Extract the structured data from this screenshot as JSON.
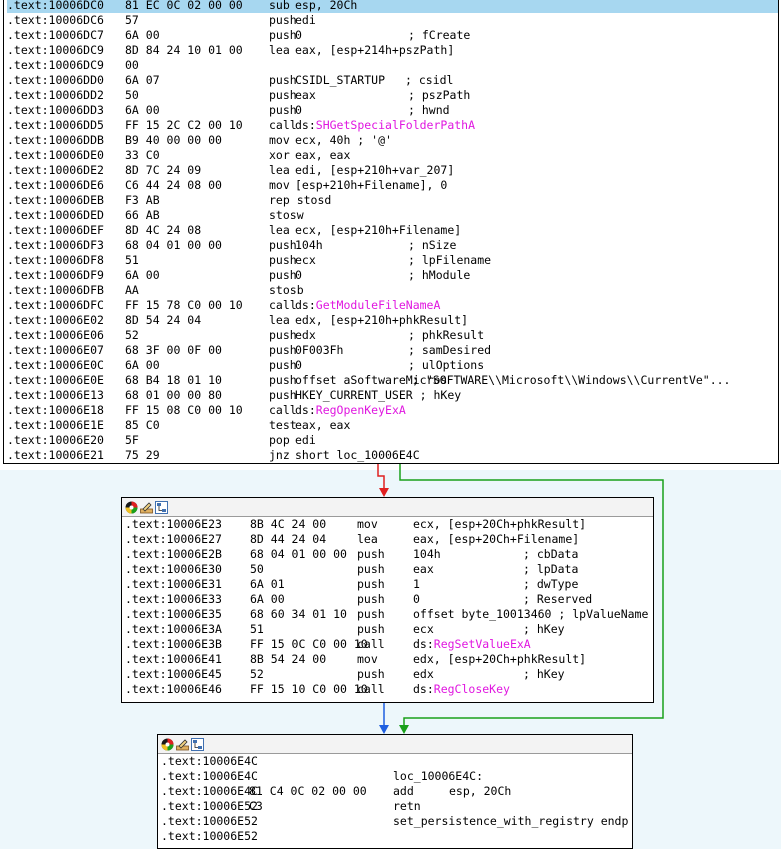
{
  "colors": {
    "api_pink": "#e017e0",
    "edge_red": "#e02020",
    "edge_green": "#1aa01a",
    "edge_blue": "#1f5fe0",
    "selected_row": "#a7d7f0",
    "background_wash": "#edf7fb"
  },
  "block_icons": [
    "graph-color-icon",
    "rename-pencil-icon",
    "graph-flowchart-icon"
  ],
  "blocks": [
    {
      "id": "main",
      "lines": [
        {
          "addr": ".text:10006DC0",
          "bytes": "81 EC 0C 02 00 00",
          "ins": "sub",
          "ops": "esp, 20Ch",
          "cmt": ""
        },
        {
          "addr": ".text:10006DC6",
          "bytes": "57",
          "ins": "push",
          "ops": "edi",
          "cmt": ""
        },
        {
          "addr": ".text:10006DC7",
          "bytes": "6A 00",
          "ins": "push",
          "ops": "0",
          "cmt": "; fCreate"
        },
        {
          "addr": ".text:10006DC9",
          "bytes": "8D 84 24 10 01 00",
          "ins": "lea",
          "ops": "eax, [esp+214h+pszPath]",
          "cmt": ""
        },
        {
          "addr": ".text:10006DC9",
          "bytes": "00",
          "ins": "",
          "ops": "",
          "cmt": ""
        },
        {
          "addr": ".text:10006DD0",
          "bytes": "6A 07",
          "ins": "push",
          "ops": "CSIDL_STARTUP",
          "cmt": "; csidl"
        },
        {
          "addr": ".text:10006DD2",
          "bytes": "50",
          "ins": "push",
          "ops": "eax",
          "cmt": "; pszPath"
        },
        {
          "addr": ".text:10006DD3",
          "bytes": "6A 00",
          "ins": "push",
          "ops": "0",
          "cmt": "; hwnd"
        },
        {
          "addr": ".text:10006DD5",
          "bytes": "FF 15 2C C2 00 10",
          "ins": "call",
          "ops": "ds:",
          "fn": "SHGetSpecialFolderPathA",
          "cmt": ""
        },
        {
          "addr": ".text:10006DDB",
          "bytes": "B9 40 00 00 00",
          "ins": "mov",
          "ops": "ecx, 40h ; '@'",
          "cmt": ""
        },
        {
          "addr": ".text:10006DE0",
          "bytes": "33 C0",
          "ins": "xor",
          "ops": "eax, eax",
          "cmt": ""
        },
        {
          "addr": ".text:10006DE2",
          "bytes": "8D 7C 24 09",
          "ins": "lea",
          "ops": "edi, [esp+210h+var_207]",
          "cmt": ""
        },
        {
          "addr": ".text:10006DE6",
          "bytes": "C6 44 24 08 00",
          "ins": "mov",
          "ops": "[esp+210h+Filename], 0",
          "cmt": ""
        },
        {
          "addr": ".text:10006DEB",
          "bytes": "F3 AB",
          "ins": "rep stosd",
          "ops": "",
          "cmt": ""
        },
        {
          "addr": ".text:10006DED",
          "bytes": "66 AB",
          "ins": "stosw",
          "ops": "",
          "cmt": ""
        },
        {
          "addr": ".text:10006DEF",
          "bytes": "8D 4C 24 08",
          "ins": "lea",
          "ops": "ecx, [esp+210h+Filename]",
          "cmt": ""
        },
        {
          "addr": ".text:10006DF3",
          "bytes": "68 04 01 00 00",
          "ins": "push",
          "ops": "104h",
          "cmt": "; nSize"
        },
        {
          "addr": ".text:10006DF8",
          "bytes": "51",
          "ins": "push",
          "ops": "ecx",
          "cmt": "; lpFilename"
        },
        {
          "addr": ".text:10006DF9",
          "bytes": "6A 00",
          "ins": "push",
          "ops": "0",
          "cmt": "; hModule"
        },
        {
          "addr": ".text:10006DFB",
          "bytes": "AA",
          "ins": "stosb",
          "ops": "",
          "cmt": ""
        },
        {
          "addr": ".text:10006DFC",
          "bytes": "FF 15 78 C0 00 10",
          "ins": "call",
          "ops": "ds:",
          "fn": "GetModuleFileNameA",
          "cmt": ""
        },
        {
          "addr": ".text:10006E02",
          "bytes": "8D 54 24 04",
          "ins": "lea",
          "ops": "edx, [esp+210h+phkResult]",
          "cmt": ""
        },
        {
          "addr": ".text:10006E06",
          "bytes": "52",
          "ins": "push",
          "ops": "edx",
          "cmt": "; phkResult"
        },
        {
          "addr": ".text:10006E07",
          "bytes": "68 3F 00 0F 00",
          "ins": "push",
          "ops": "0F003Fh",
          "cmt": "; samDesired"
        },
        {
          "addr": ".text:10006E0C",
          "bytes": "6A 00",
          "ins": "push",
          "ops": "0",
          "cmt": "; ulOptions"
        },
        {
          "addr": ".text:10006E0E",
          "bytes": "68 B4 18 01 10",
          "ins": "push",
          "ops": "offset aSoftwareMicros",
          "cmt": "; \"SOFTWARE\\\\Microsoft\\\\Windows\\\\CurrentVe\"..."
        },
        {
          "addr": ".text:10006E13",
          "bytes": "68 01 00 00 80",
          "ins": "push",
          "ops": "HKEY_CURRENT_USER ; hKey",
          "cmt": ""
        },
        {
          "addr": ".text:10006E18",
          "bytes": "FF 15 08 C0 00 10",
          "ins": "call",
          "ops": "ds:",
          "fn": "RegOpenKeyExA",
          "cmt": ""
        },
        {
          "addr": ".text:10006E1E",
          "bytes": "85 C0",
          "ins": "test",
          "ops": "eax, eax",
          "cmt": ""
        },
        {
          "addr": ".text:10006E20",
          "bytes": "5F",
          "ins": "pop",
          "ops": "edi",
          "cmt": ""
        },
        {
          "addr": ".text:10006E21",
          "bytes": "75 29",
          "ins": "jnz",
          "ops": "short loc_10006E4C",
          "cmt": ""
        }
      ]
    },
    {
      "id": "b2",
      "lines": [
        {
          "addr": ".text:10006E23",
          "bytes": "8B 4C 24 00",
          "ins": "mov",
          "ops": "ecx, [esp+20Ch+phkResult]",
          "cmt": ""
        },
        {
          "addr": ".text:10006E27",
          "bytes": "8D 44 24 04",
          "ins": "lea",
          "ops": "eax, [esp+20Ch+Filename]",
          "cmt": ""
        },
        {
          "addr": ".text:10006E2B",
          "bytes": "68 04 01 00 00",
          "ins": "push",
          "ops": "104h",
          "cmt": "; cbData"
        },
        {
          "addr": ".text:10006E30",
          "bytes": "50",
          "ins": "push",
          "ops": "eax",
          "cmt": "; lpData"
        },
        {
          "addr": ".text:10006E31",
          "bytes": "6A 01",
          "ins": "push",
          "ops": "1",
          "cmt": "; dwType"
        },
        {
          "addr": ".text:10006E33",
          "bytes": "6A 00",
          "ins": "push",
          "ops": "0",
          "cmt": "; Reserved"
        },
        {
          "addr": ".text:10006E35",
          "bytes": "68 60 34 01 10",
          "ins": "push",
          "ops": "offset byte_10013460 ; lpValueName",
          "cmt": ""
        },
        {
          "addr": ".text:10006E3A",
          "bytes": "51",
          "ins": "push",
          "ops": "ecx",
          "cmt": "; hKey"
        },
        {
          "addr": ".text:10006E3B",
          "bytes": "FF 15 0C C0 00 10",
          "ins": "call",
          "ops": "ds:",
          "fn": "RegSetValueExA",
          "cmt": ""
        },
        {
          "addr": ".text:10006E41",
          "bytes": "8B 54 24 00",
          "ins": "mov",
          "ops": "edx, [esp+20Ch+phkResult]",
          "cmt": ""
        },
        {
          "addr": ".text:10006E45",
          "bytes": "52",
          "ins": "push",
          "ops": "edx",
          "cmt": "; hKey"
        },
        {
          "addr": ".text:10006E46",
          "bytes": "FF 15 10 C0 00 10",
          "ins": "call",
          "ops": "ds:",
          "fn": "RegCloseKey",
          "cmt": ""
        }
      ]
    },
    {
      "id": "b3",
      "lines": [
        {
          "addr": ".text:10006E4C",
          "bytes": "",
          "ins": "",
          "ops": "",
          "cmt": ""
        },
        {
          "addr": ".text:10006E4C",
          "bytes": "",
          "ins": "loc_10006E4C:",
          "ops": "",
          "cmt": ""
        },
        {
          "addr": ".text:10006E4C",
          "bytes": "81 C4 0C 02 00 00",
          "ins": "add",
          "ops": "esp, 20Ch",
          "cmt": ""
        },
        {
          "addr": ".text:10006E52",
          "bytes": "C3",
          "ins": "retn",
          "ops": "",
          "cmt": ""
        },
        {
          "addr": ".text:10006E52",
          "bytes": "",
          "ins": "set_persistence_with_registry endp",
          "ops": "",
          "cmt": ""
        },
        {
          "addr": ".text:10006E52",
          "bytes": "",
          "ins": "",
          "ops": "",
          "cmt": ""
        }
      ]
    }
  ]
}
